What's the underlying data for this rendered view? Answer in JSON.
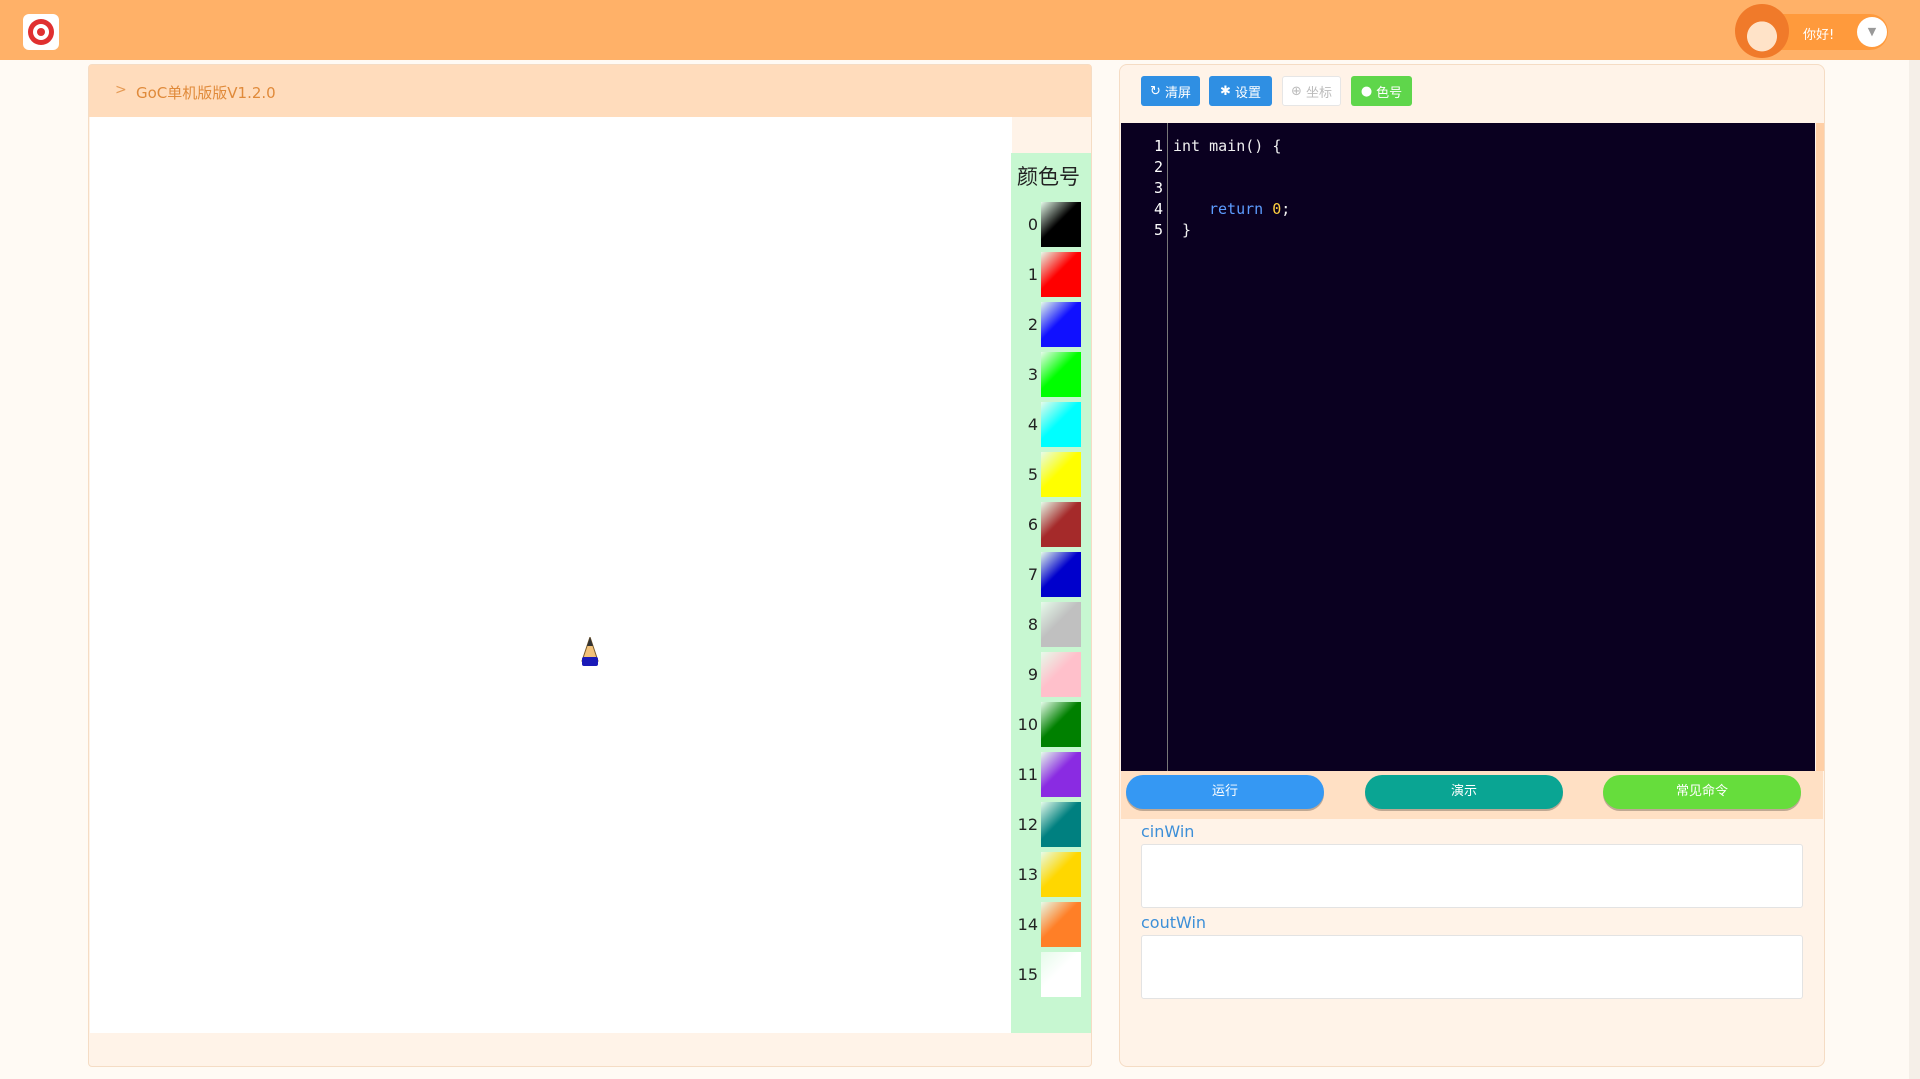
{
  "header": {
    "greeting": "你好!"
  },
  "left_panel": {
    "title": "GoC单机版版V1.2.0"
  },
  "palette": {
    "title": "颜色号",
    "colors": [
      {
        "num": "0",
        "color": "#000000"
      },
      {
        "num": "1",
        "color": "#ff0000"
      },
      {
        "num": "2",
        "color": "#1010ff"
      },
      {
        "num": "3",
        "color": "#00ff00"
      },
      {
        "num": "4",
        "color": "#00ffff"
      },
      {
        "num": "5",
        "color": "#ffff00"
      },
      {
        "num": "6",
        "color": "#a52a2a"
      },
      {
        "num": "7",
        "color": "#0000cc"
      },
      {
        "num": "8",
        "color": "#c0c0c0"
      },
      {
        "num": "9",
        "color": "#ffc0cb"
      },
      {
        "num": "10",
        "color": "#008000"
      },
      {
        "num": "11",
        "color": "#8a2be2"
      },
      {
        "num": "12",
        "color": "#008080"
      },
      {
        "num": "13",
        "color": "#ffd700"
      },
      {
        "num": "14",
        "color": "#ff7f27"
      },
      {
        "num": "15",
        "color": "#ffffff"
      }
    ]
  },
  "toolbar": {
    "clear_label": "清屏",
    "settings_label": "设置",
    "coord_label": "坐标",
    "color_label": "色号"
  },
  "editor": {
    "lines": [
      {
        "n": "1",
        "text": "int main() {"
      },
      {
        "n": "2",
        "text": ""
      },
      {
        "n": "3",
        "text": ""
      },
      {
        "n": "4",
        "kw": "return",
        "num": "0",
        "rest": ";"
      },
      {
        "n": "5",
        "text": " }"
      }
    ]
  },
  "actions": {
    "run_label": "运行",
    "demo_label": "演示",
    "commands_label": "常见命令"
  },
  "io": {
    "cin_label": "cinWin",
    "cout_label": "coutWin"
  }
}
